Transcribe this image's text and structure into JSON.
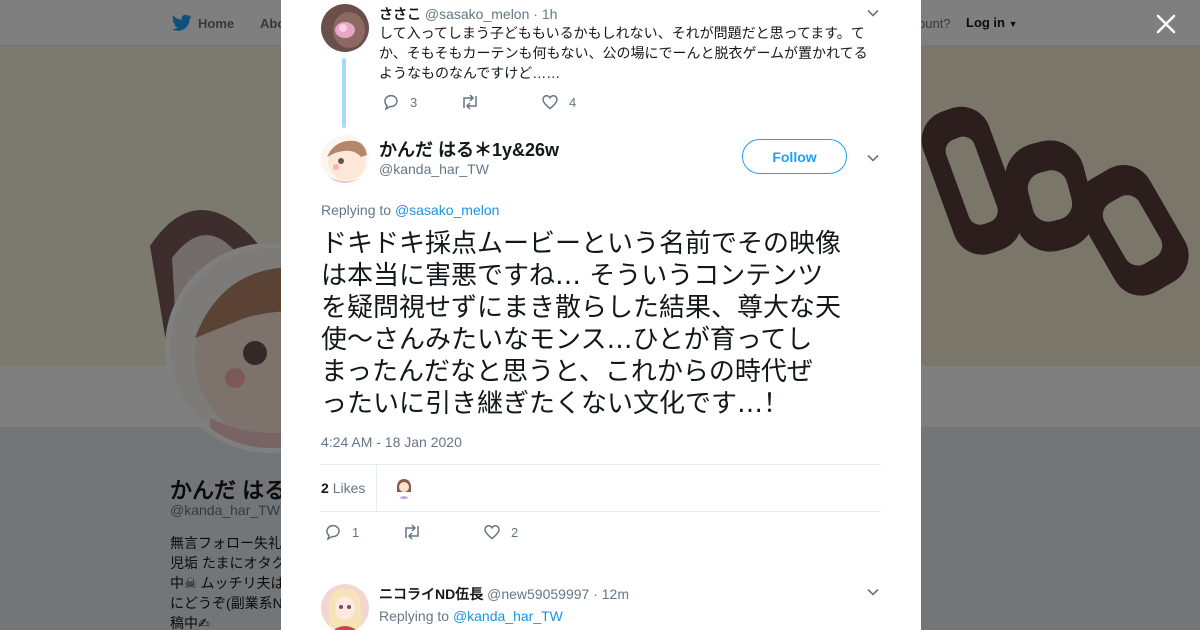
{
  "nav": {
    "home_label": "Home",
    "about_label": "Abo",
    "account_text": "ccount?",
    "login_label": "Log in"
  },
  "profile": {
    "name": "かんだ はる",
    "handle": "@kanda_har_TW",
    "bio_lines": [
      "無言フォロー失礼",
      "児垢 たまにオタク",
      "中☠ ムッチリ夫は",
      "にどうぞ(副業系N",
      "稿中✍"
    ]
  },
  "parent_tweet": {
    "name": "ささこ",
    "handle": "@sasako_melon",
    "separator": "·",
    "time": "1h",
    "text_lines": [
      "して入ってしまう子どももいるかもしれない、それが問題だと思ってます。て",
      "か、そもそもカーテンも何もない、公の場にでーんと脱衣ゲームが置かれてる",
      "ようなものなんですけど……"
    ],
    "reply_count": "3",
    "retweet_count": "",
    "like_count": "4"
  },
  "main_tweet": {
    "name": "かんだ はる＊1y&26w",
    "handle": "@kanda_har_TW",
    "follow_label": "Follow",
    "replying_prefix": "Replying to",
    "replying_to": "@sasako_melon",
    "text_lines": [
      "ドキドキ採点ムービーという名前でその映像",
      "は本当に害悪ですね… そういうコンテンツ",
      "を疑問視せずにまき散らした結果、尊大な天",
      "使〜さんみたいなモンス…ひとが育ってし",
      "まったんだなと思うと、これからの時代ぜ",
      "ったいに引き継ぎたくない文化です…！"
    ],
    "timestamp": "4:24 AM - 18 Jan 2020",
    "likes_number": "2",
    "likes_label": "Likes",
    "reply_count": "1",
    "retweet_count": "",
    "like_count": "2"
  },
  "reply_tweet": {
    "name": "ニコライND伍長",
    "handle": "@new59059997",
    "separator": "·",
    "time": "12m",
    "replying_prefix": "Replying to",
    "replying_to": "@kanda_har_TW"
  },
  "colors": {
    "twitter_blue": "#1da1f2",
    "link_blue": "#1b95e0",
    "thread_line": "#a4d9f9",
    "secondary_text": "#657786",
    "banner": "#f4efd4"
  }
}
